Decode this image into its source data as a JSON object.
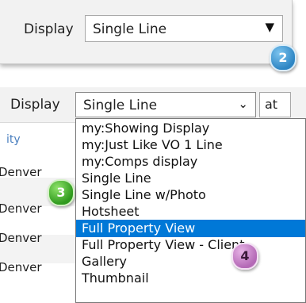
{
  "panel1": {
    "label": "Display",
    "select_value": "Single Line",
    "arrow": "▼",
    "callout": "2"
  },
  "panel2": {
    "label": "Display",
    "select_value": "Single Line",
    "chevron": "⌄",
    "at_text": "at",
    "column_header": "ity",
    "rows": [
      "Denver",
      "Denver",
      "Denver",
      "Denver"
    ],
    "options": [
      "my:Showing Display",
      "my:Just Like VO 1 Line",
      "my:Comps display",
      "Single Line",
      "Single Line w/Photo",
      "Hotsheet",
      "Full Property View",
      "Full Property View - Client",
      "Gallery",
      "Thumbnail"
    ],
    "highlighted_option": "Full Property View",
    "callout_single_line": "3",
    "callout_full_property": "4"
  },
  "colors": {
    "highlight": "#0078d7",
    "callout_2": "#2f86c4",
    "callout_3": "#2f9a1e",
    "callout_4": "#b469b6"
  }
}
